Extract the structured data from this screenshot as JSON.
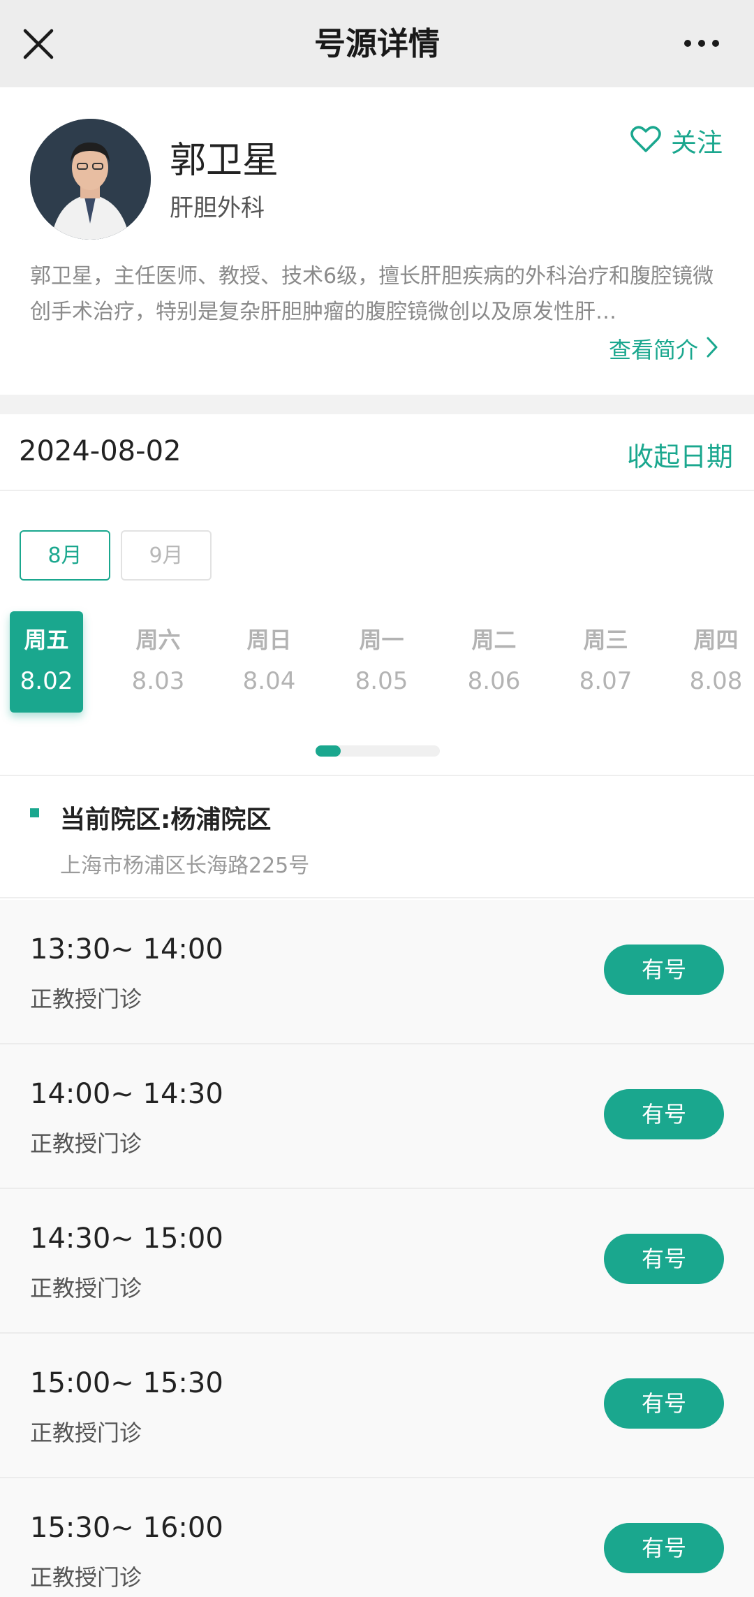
{
  "nav": {
    "title": "号源详情"
  },
  "doctor": {
    "name": "郭卫星",
    "department": "肝胆外科",
    "follow_label": "关注",
    "intro": "郭卫星，主任医师、教授、技术6级，擅长肝胆疾病的外科治疗和腹腔镜微创手术治疗，特别是复杂肝胆肿瘤的腹腔镜微创以及原发性肝…",
    "intro_link": "查看简介"
  },
  "date_section": {
    "current_date": "2024-08-02",
    "collapse_label": "收起日期",
    "months": [
      {
        "label": "8月",
        "selected": true
      },
      {
        "label": "9月",
        "selected": false
      }
    ],
    "days": [
      {
        "weekday": "周五",
        "date": "8.02",
        "selected": true
      },
      {
        "weekday": "周六",
        "date": "8.03",
        "selected": false
      },
      {
        "weekday": "周日",
        "date": "8.04",
        "selected": false
      },
      {
        "weekday": "周一",
        "date": "8.05",
        "selected": false
      },
      {
        "weekday": "周二",
        "date": "8.06",
        "selected": false
      },
      {
        "weekday": "周三",
        "date": "8.07",
        "selected": false
      },
      {
        "weekday": "周四",
        "date": "8.08",
        "selected": false
      }
    ]
  },
  "campus": {
    "name": "当前院区:杨浦院区",
    "address": "上海市杨浦区长海路225号"
  },
  "slots": [
    {
      "time": "13:30~ 14:00",
      "type": "正教授门诊",
      "status": "有号"
    },
    {
      "time": "14:00~ 14:30",
      "type": "正教授门诊",
      "status": "有号"
    },
    {
      "time": "14:30~ 15:00",
      "type": "正教授门诊",
      "status": "有号"
    },
    {
      "time": "15:00~ 15:30",
      "type": "正教授门诊",
      "status": "有号"
    },
    {
      "time": "15:30~ 16:00",
      "type": "正教授门诊",
      "status": "有号"
    }
  ],
  "colors": {
    "accent": "#1aa78e",
    "navbar": "#ededed",
    "muted": "#b3b3b3"
  }
}
